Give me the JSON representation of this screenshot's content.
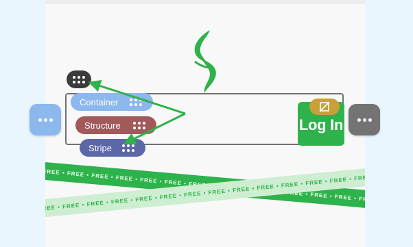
{
  "ribbon": {
    "green_text": "FREE • FREE • FREE • FREE • FREE • FREE • FREE • FREE • FREE • FREE • FREE • FREE • FREE • FREE • FREE •",
    "light_text": "FREE FREE • FREE • FREE • FREE • FREE • FREE • FREE • FREE • FREE • FREE • FREE • FREE • FREE • FREE •"
  },
  "login": {
    "label": "Log In"
  },
  "chips": {
    "container": "Container",
    "structure": "Structure",
    "stripe": "Stripe"
  },
  "icons": {
    "logo": "s-swoosh-logo",
    "left_handle": "more-horizontal-icon",
    "right_handle": "more-horizontal-icon",
    "top_handle": "drag-grid-icon",
    "unlink_badge": "link-off-icon"
  },
  "colors": {
    "brand_green": "#2eb24b",
    "light_green": "#cdeed1",
    "container_chip": "#8db8ee",
    "structure_chip": "#a15959",
    "stripe_chip": "#5b67a6",
    "badge": "#c8a03a",
    "right_handle": "#737373",
    "top_handle": "#3b3b3b"
  }
}
